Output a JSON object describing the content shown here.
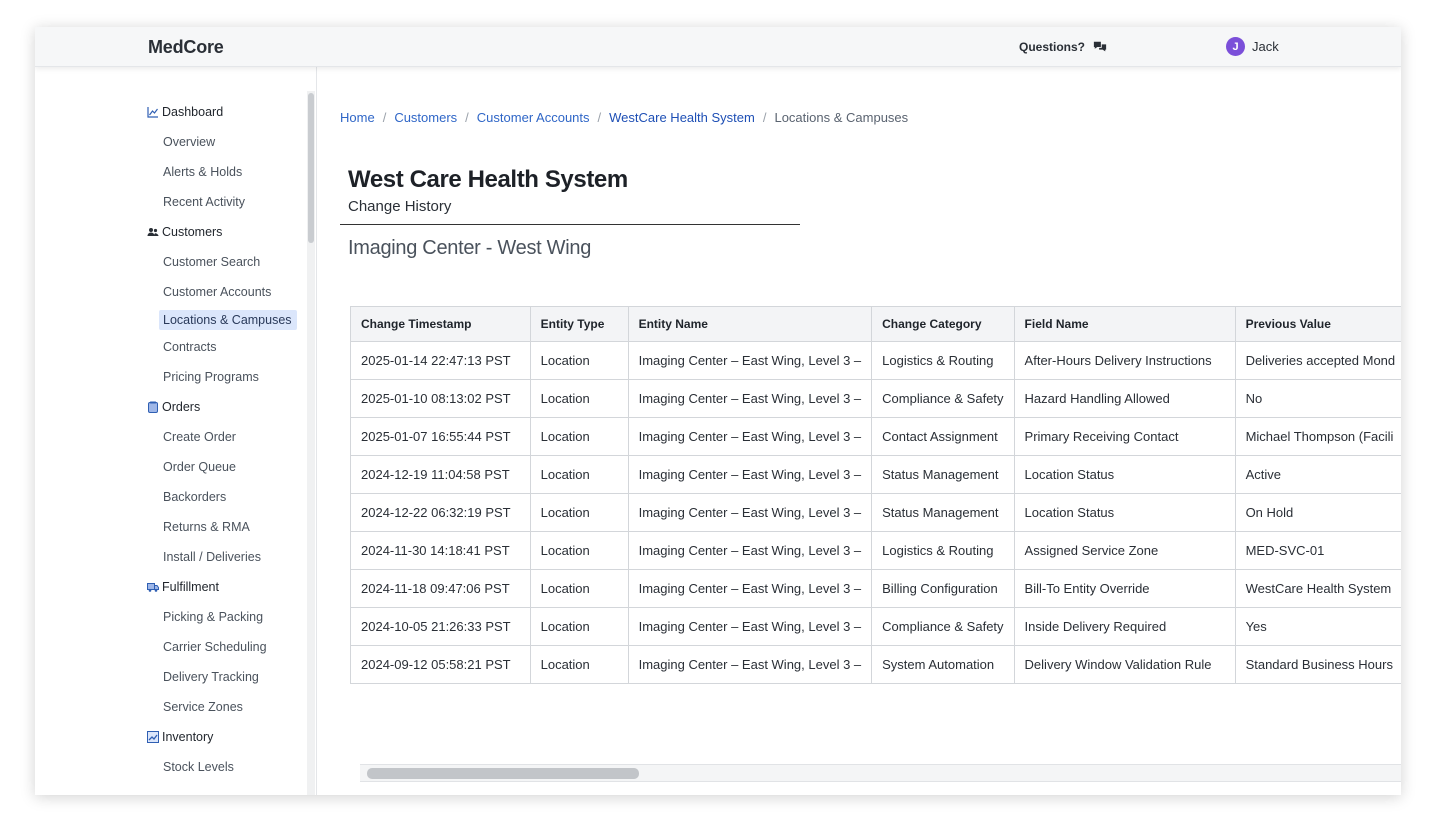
{
  "header": {
    "brand": "MedCore",
    "questions_label": "Questions?",
    "user_initial": "J",
    "user_name": "Jack"
  },
  "sidebar": {
    "sections": [
      {
        "label": "Dashboard",
        "icon": "chart-icon",
        "items": [
          "Overview",
          "Alerts & Holds",
          "Recent Activity"
        ]
      },
      {
        "label": "Customers",
        "icon": "users-icon",
        "items": [
          "Customer Search",
          "Customer Accounts",
          "Locations & Campuses",
          "Contracts",
          "Pricing Programs"
        ]
      },
      {
        "label": "Orders",
        "icon": "clipboard-icon",
        "items": [
          "Create Order",
          "Order Queue",
          "Backorders",
          "Returns & RMA",
          "Install / Deliveries"
        ]
      },
      {
        "label": "Fulfillment",
        "icon": "truck-icon",
        "items": [
          "Picking & Packing",
          "Carrier Scheduling",
          "Delivery Tracking",
          "Service Zones"
        ]
      },
      {
        "label": "Inventory",
        "icon": "trend-icon",
        "items": [
          "Stock Levels"
        ]
      }
    ],
    "active_item": "Locations & Campuses"
  },
  "breadcrumb": [
    "Home",
    "Customers",
    "Customer Accounts",
    "WestCare Health System",
    "Locations & Campuses"
  ],
  "page": {
    "title": "West Care Health System",
    "subtitle": "Change History",
    "section_title": "Imaging Center - West Wing"
  },
  "table": {
    "columns": [
      "Change Timestamp",
      "Entity Type",
      "Entity Name",
      "Change Category",
      "Field Name",
      "Previous Value"
    ],
    "rows": [
      [
        "2025-01-14 22:47:13 PST",
        "Location",
        "Imaging Center – East Wing, Level 3 –",
        "Logistics & Routing",
        "After-Hours Delivery Instructions",
        "Deliveries accepted Mond"
      ],
      [
        "2025-01-10 08:13:02 PST",
        "Location",
        "Imaging Center – East Wing, Level 3 –",
        "Compliance & Safety",
        "Hazard Handling Allowed",
        "No"
      ],
      [
        "2025-01-07 16:55:44 PST",
        "Location",
        "Imaging Center – East Wing, Level 3 –",
        "Contact Assignment",
        "Primary Receiving Contact",
        "Michael Thompson (Facili"
      ],
      [
        "2024-12-19 11:04:58 PST",
        "Location",
        "Imaging Center – East Wing, Level 3 –",
        "Status Management",
        "Location Status",
        "Active"
      ],
      [
        "2024-12-22 06:32:19 PST",
        "Location",
        "Imaging Center – East Wing, Level 3 –",
        "Status Management",
        "Location Status",
        "On Hold"
      ],
      [
        "2024-11-30 14:18:41 PST",
        "Location",
        "Imaging Center – East Wing, Level 3 –",
        "Logistics & Routing",
        "Assigned Service Zone",
        "MED-SVC-01"
      ],
      [
        "2024-11-18 09:47:06 PST",
        "Location",
        "Imaging Center – East Wing, Level 3 –",
        "Billing Configuration",
        "Bill-To Entity Override",
        "WestCare Health System"
      ],
      [
        "2024-10-05 21:26:33 PST",
        "Location",
        "Imaging Center – East Wing, Level 3 –",
        "Compliance & Safety",
        "Inside Delivery Required",
        "Yes"
      ],
      [
        "2024-09-12 05:58:21 PST",
        "Location",
        "Imaging Center – East Wing, Level 3 –",
        "System Automation",
        "Delivery Window Validation Rule",
        "Standard Business Hours"
      ]
    ]
  },
  "colors": {
    "link": "#2f66c7",
    "active_bg": "#dbe6fb",
    "avatar": "#7b4fd9"
  }
}
